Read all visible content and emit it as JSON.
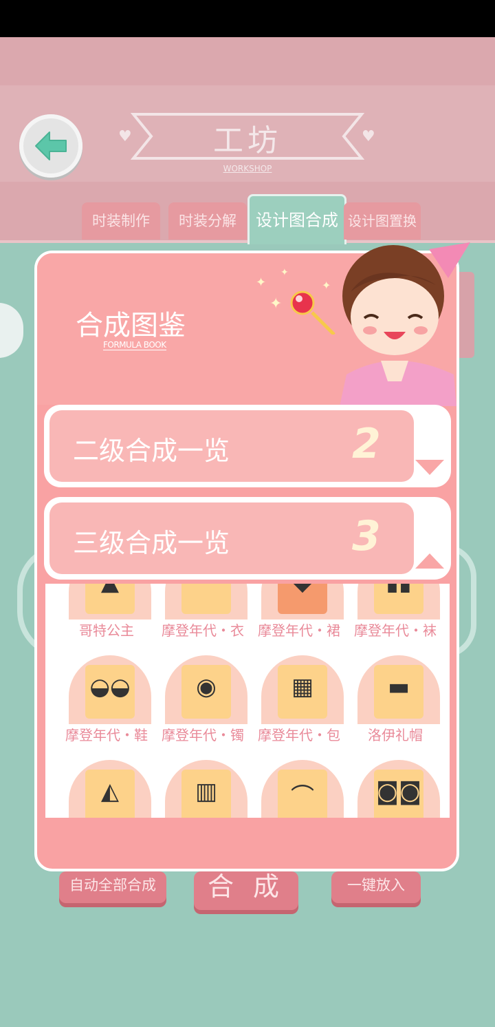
{
  "header": {
    "title": "工坊",
    "subtitle": "WORKSHOP"
  },
  "tabs": [
    {
      "label": "时装制作"
    },
    {
      "label": "时装分解"
    },
    {
      "label": "设计图合成"
    },
    {
      "label": "设计图置换"
    }
  ],
  "active_tab": "设计图合成",
  "book": {
    "title": "合成图鉴",
    "subtitle": "FORMULA BOOK"
  },
  "levels": [
    {
      "label": "二级合成一览",
      "number": "2"
    },
    {
      "label": "三级合成一览",
      "number": "3"
    }
  ],
  "items": [
    {
      "label": "哥特公主",
      "icon": "dress-icon"
    },
    {
      "label": "摩登年代・衣",
      "icon": "top-icon"
    },
    {
      "label": "摩登年代・裙",
      "icon": "skirt-icon"
    },
    {
      "label": "摩登年代・袜",
      "icon": "socks-icon"
    },
    {
      "label": "摩登年代・鞋",
      "icon": "shoes-icon"
    },
    {
      "label": "摩登年代・镯",
      "icon": "bracelet-icon"
    },
    {
      "label": "摩登年代・包",
      "icon": "bag-icon"
    },
    {
      "label": "洛伊礼帽",
      "icon": "hat-icon"
    },
    {
      "label": "",
      "icon": "jacket-icon"
    },
    {
      "label": "",
      "icon": "vest-icon"
    },
    {
      "label": "",
      "icon": "belt-icon"
    },
    {
      "label": "",
      "icon": "sandals-icon"
    }
  ],
  "buttons": {
    "auto": "自动全部合成",
    "compose": "合 成",
    "one_click": "一键放入"
  }
}
